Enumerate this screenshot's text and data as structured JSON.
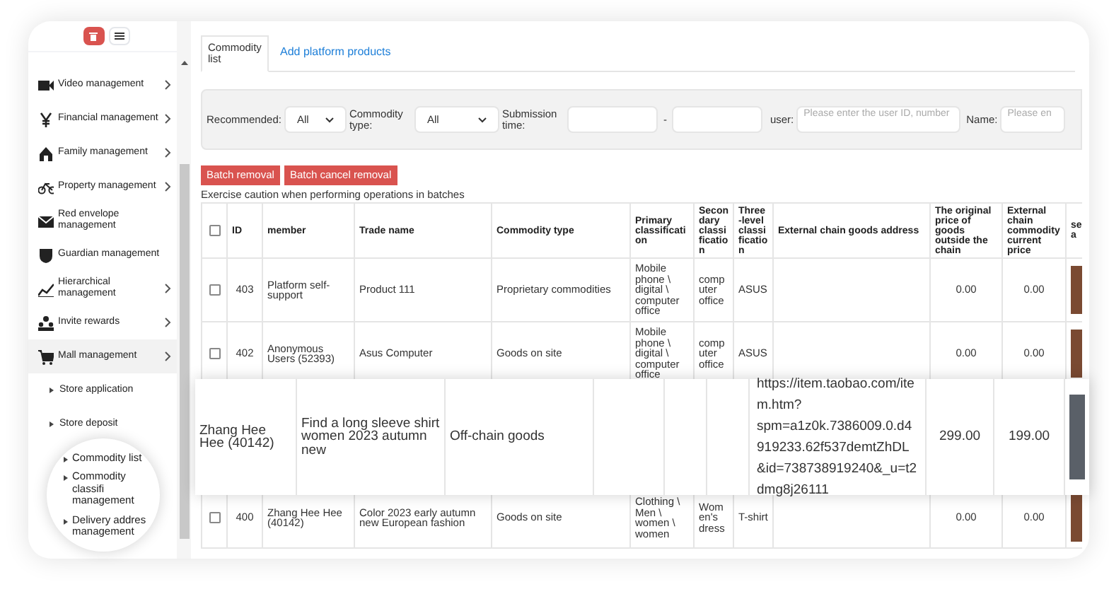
{
  "sidebar": {
    "items": [
      {
        "label": "Video management",
        "expandable": true,
        "selected": false
      },
      {
        "label": "Financial management",
        "expandable": true,
        "selected": false
      },
      {
        "label": "Family management",
        "expandable": true,
        "selected": false
      },
      {
        "label": "Property management",
        "expandable": true,
        "selected": false
      },
      {
        "label": "Red envelope management",
        "expandable": false,
        "selected": false
      },
      {
        "label": "Guardian management",
        "expandable": false,
        "selected": false
      },
      {
        "label": "Hierarchical management",
        "expandable": true,
        "selected": false
      },
      {
        "label": "Invite rewards",
        "expandable": true,
        "selected": false
      },
      {
        "label": "Mall management",
        "expandable": true,
        "selected": true,
        "children": [
          {
            "label": "Store application"
          },
          {
            "label": "Store deposit"
          }
        ]
      }
    ]
  },
  "magnifier": {
    "items": [
      "Commodity list",
      "Commodity classifi management",
      "Delivery addres management"
    ]
  },
  "tabs": [
    {
      "label": "Commodity list",
      "selected": true
    },
    {
      "label": "Add platform products",
      "selected": false
    }
  ],
  "filters": [
    {
      "kind": "select",
      "label": "Recommended:",
      "value": "All"
    },
    {
      "kind": "select",
      "label": "Commodity type:",
      "value": "All"
    },
    {
      "kind": "range",
      "label": "Submission time:",
      "separator": "-"
    },
    {
      "kind": "text",
      "label": "user:",
      "placeholder": "Please enter the user ID, number"
    },
    {
      "kind": "text",
      "label": "Name:",
      "placeholder": "Please en"
    }
  ],
  "actions": [
    "Batch removal",
    "Batch cancel removal"
  ],
  "note": "Exercise caution when performing operations in batches",
  "table": {
    "all_checked": false,
    "columns": [
      "ID",
      "member",
      "Trade name",
      "Commodity type",
      "Primary classification",
      "Secondary classification",
      "Three-level classification",
      "External chain goods address",
      "The original price of goods outside the chain",
      "External chain commodity current price",
      "sea"
    ],
    "rows": [
      {
        "kind": "row",
        "checked": false,
        "id": "403",
        "member": "Platform self-support",
        "trade_name": "Product 111",
        "commodity_type": "Proprietary commodities",
        "primary": "Mobile phone \\ digital \\ computer office",
        "secondary": "computer office",
        "three_level": "ASUS",
        "original_price": "0.00",
        "current_price": "0.00"
      },
      {
        "kind": "row",
        "checked": false,
        "id": "402",
        "member": "Anonymous Users (52393)",
        "trade_name": "Asus Computer",
        "commodity_type": "Goods on site",
        "primary": "Mobile phone \\ digital \\ computer office",
        "secondary": "computer office",
        "three_level": "ASUS",
        "original_price": "0.00",
        "current_price": "0.00"
      },
      {
        "kind": "callout",
        "member": "Zhang Hee Hee (40142)",
        "trade_name": "Find a long sleeve shirt women 2023 autumn new",
        "commodity_type": "Off-chain goods",
        "address": "https://item.taobao.com/item.htm?spm=a1z0k.7386009.0.d4919233.62f537demtZhDL&id=738738919240&_u=t2dmg8j26111",
        "original_price": "299.00",
        "current_price": "199.00"
      },
      {
        "kind": "row",
        "checked": false,
        "id": "400",
        "member": "Zhang Hee Hee (40142)",
        "trade_name": "Color 2023 early autumn new European fashion",
        "commodity_type": "Goods on site",
        "primary": "Clothing \\ Men \\ women \\ women",
        "secondary": "Women's dress",
        "three_level": "T-shirt",
        "original_price": "0.00",
        "current_price": "0.00"
      }
    ]
  }
}
